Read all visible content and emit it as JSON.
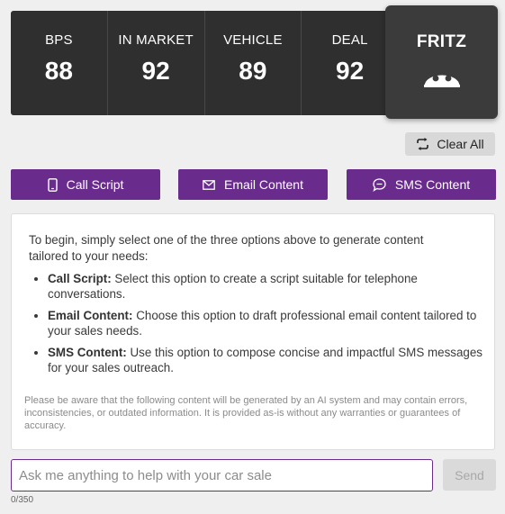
{
  "scores": [
    {
      "label": "BPS",
      "value": "88"
    },
    {
      "label": "IN MARKET",
      "value": "92"
    },
    {
      "label": "VEHICLE",
      "value": "89"
    },
    {
      "label": "DEAL",
      "value": "92"
    }
  ],
  "fritz": {
    "label": "FRITZ",
    "icon": "robot-face-icon"
  },
  "toolbar": {
    "clear_label": "Clear All",
    "clear_icon": "refresh-icon"
  },
  "actions": {
    "call": {
      "label": "Call Script",
      "icon": "phone-icon"
    },
    "email": {
      "label": "Email Content",
      "icon": "envelope-icon"
    },
    "sms": {
      "label": "SMS Content",
      "icon": "chat-bubble-icon"
    }
  },
  "card": {
    "intro": "To begin, simply select one of the three options above to generate content tailored to your needs:",
    "options": [
      {
        "title": "Call Script:",
        "text": " Select this option to create a script suitable for telephone conversations."
      },
      {
        "title": "Email Content:",
        "text": " Choose this option to draft professional email content tailored to your sales needs."
      },
      {
        "title": "SMS Content:",
        "text": " Use this option to compose concise and impactful SMS messages for your sales outreach."
      }
    ],
    "disclaimer": "Please be aware that the following content will be generated by an AI system and may contain errors, inconsistencies, or outdated information. It is provided as-is without any warranties or guarantees of accuracy."
  },
  "input": {
    "value": "",
    "placeholder": "Ask me anything to help with your car sale",
    "counter": "0/350"
  },
  "send": {
    "label": "Send"
  },
  "colors": {
    "accent": "#6a2c8c",
    "dark_panel": "#2f2f2f",
    "background": "#efefef"
  }
}
